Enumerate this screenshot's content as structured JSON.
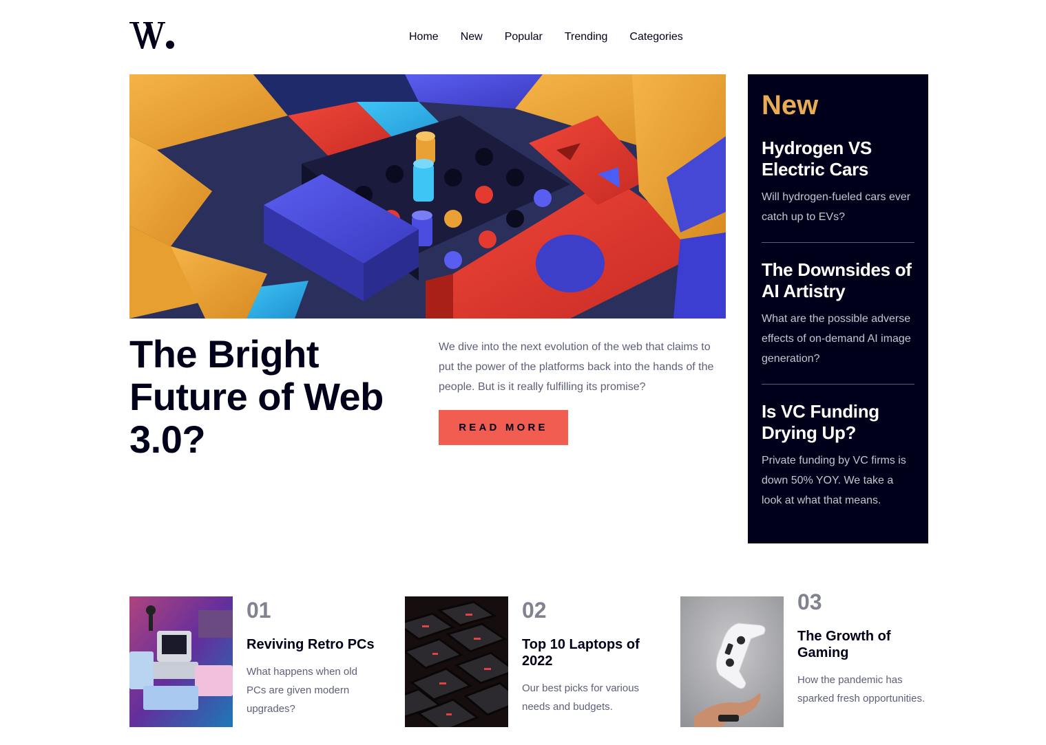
{
  "brand": {
    "logo_text": "W."
  },
  "nav": {
    "items": [
      {
        "label": "Home"
      },
      {
        "label": "New"
      },
      {
        "label": "Popular"
      },
      {
        "label": "Trending"
      },
      {
        "label": "Categories"
      }
    ]
  },
  "hero": {
    "title": "The Bright Future of Web 3.0?",
    "description": "We dive into the next evolution of the web that claims to put the power of the platforms back into the hands of the people. But is it really fulfilling its promise?",
    "cta_label": "READ MORE"
  },
  "new_panel": {
    "heading": "New",
    "items": [
      {
        "title": "Hydrogen VS Electric Cars",
        "description": "Will hydrogen-fueled cars ever catch up to EVs?"
      },
      {
        "title": "The Downsides of AI Artistry",
        "description": "What are the possible adverse effects of on-demand AI image generation?"
      },
      {
        "title": "Is VC Funding Drying Up?",
        "description": "Private funding by VC firms is down 50% YOY. We take a look at what that means."
      }
    ]
  },
  "cards": [
    {
      "number": "01",
      "title": "Reviving Retro PCs",
      "description": "What happens when old PCs are given modern upgrades?"
    },
    {
      "number": "02",
      "title": "Top 10 Laptops of 2022",
      "description": "Our best picks for various needs and budgets."
    },
    {
      "number": "03",
      "title": "The Growth of Gaming",
      "description": "How the pandemic has sparked fresh opportunities."
    }
  ],
  "colors": {
    "dark_navy": "#00001a",
    "soft_orange": "#e9ab53",
    "soft_red": "#f15d51",
    "grayish_blue": "#5d5f79",
    "off_white": "#ffffff"
  }
}
